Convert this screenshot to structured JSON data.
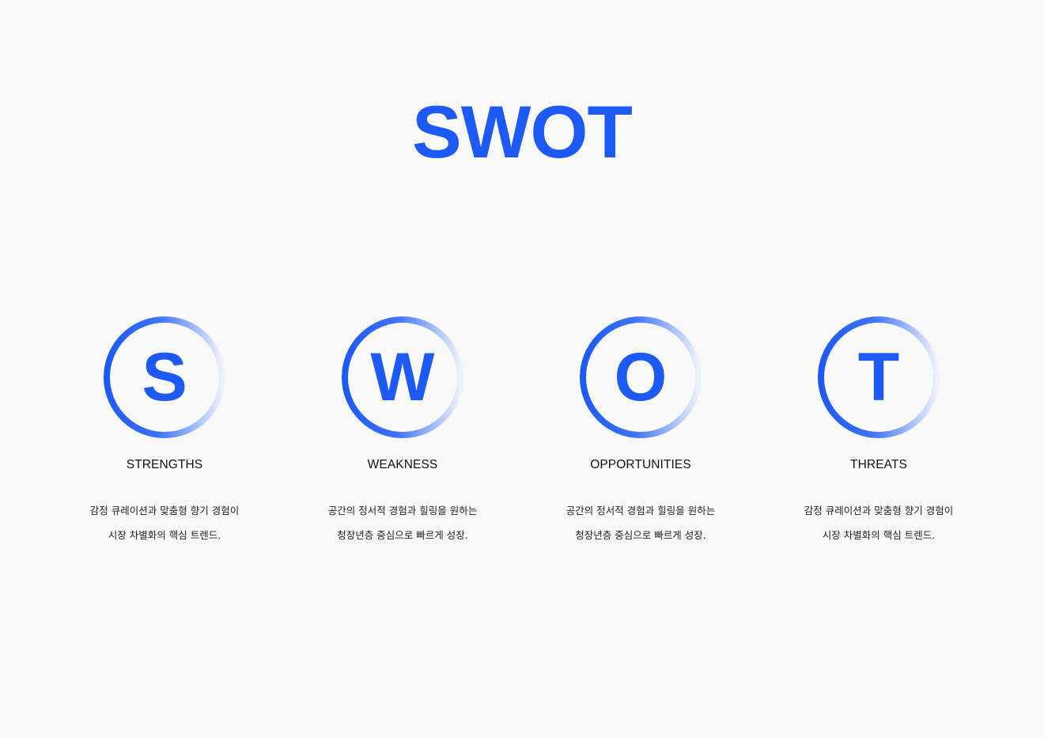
{
  "title": "SWOT",
  "accent_color": "#1d5af5",
  "items": [
    {
      "letter": "S",
      "heading": "STRENGTHS",
      "line1": "감정 큐레이션과 맞춤형 향기 경험이",
      "line2": "시장 차별화의 핵심 트렌드."
    },
    {
      "letter": "W",
      "heading": "WEAKNESS",
      "line1": "공간의 정서적 경험과 힐링을 원하는",
      "line2": "청장년층 중심으로 빠르게 성장."
    },
    {
      "letter": "O",
      "heading": "OPPORTUNITIES",
      "line1": "공간의 정서적 경험과 힐링을 원하는",
      "line2": "청장년층 중심으로 빠르게 성장."
    },
    {
      "letter": "T",
      "heading": "THREATS",
      "line1": "감정 큐레이션과 맞춤형 향기 경험이",
      "line2": "시장 차별화의 핵심 트렌드."
    }
  ]
}
